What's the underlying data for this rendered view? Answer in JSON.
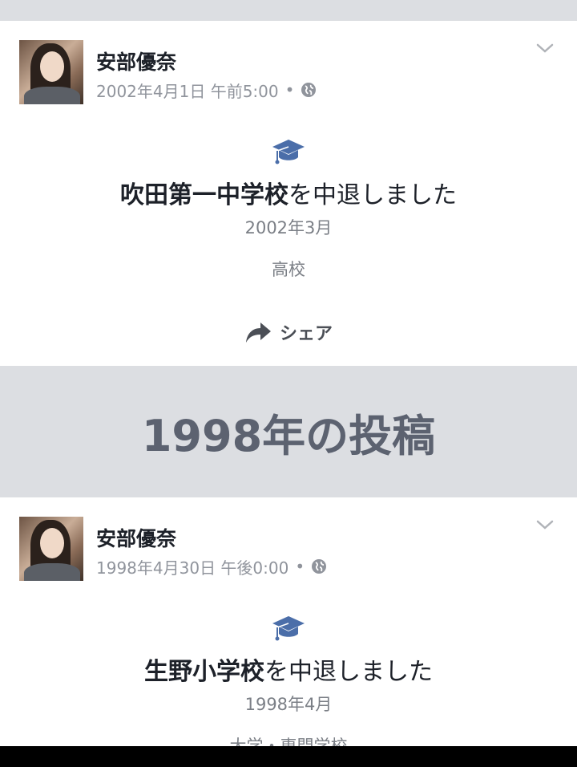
{
  "posts": [
    {
      "author": "安部優奈",
      "timestamp": "2002年4月1日 午前5:00",
      "separator": "•",
      "privacy_icon": "globe-icon",
      "event_icon": "graduation-cap-icon",
      "event_school_name": "吹田第一中学校",
      "event_action": "を中退しました",
      "event_date": "2002年3月",
      "event_school_type": "高校",
      "share_label": "シェア"
    },
    {
      "author": "安部優奈",
      "timestamp": "1998年4月30日 午後0:00",
      "separator": "•",
      "privacy_icon": "globe-icon",
      "event_icon": "graduation-cap-icon",
      "event_school_name": "生野小学校",
      "event_action": "を中退しました",
      "event_date": "1998年4月",
      "event_school_type": "大学・専門学校"
    }
  ],
  "section_header": "1998年の投稿",
  "colors": {
    "background": "#dcdee2",
    "card": "#ffffff",
    "icon_accent": "#4b6ea9",
    "title_text": "#1d2129",
    "meta_text": "#90949c"
  }
}
